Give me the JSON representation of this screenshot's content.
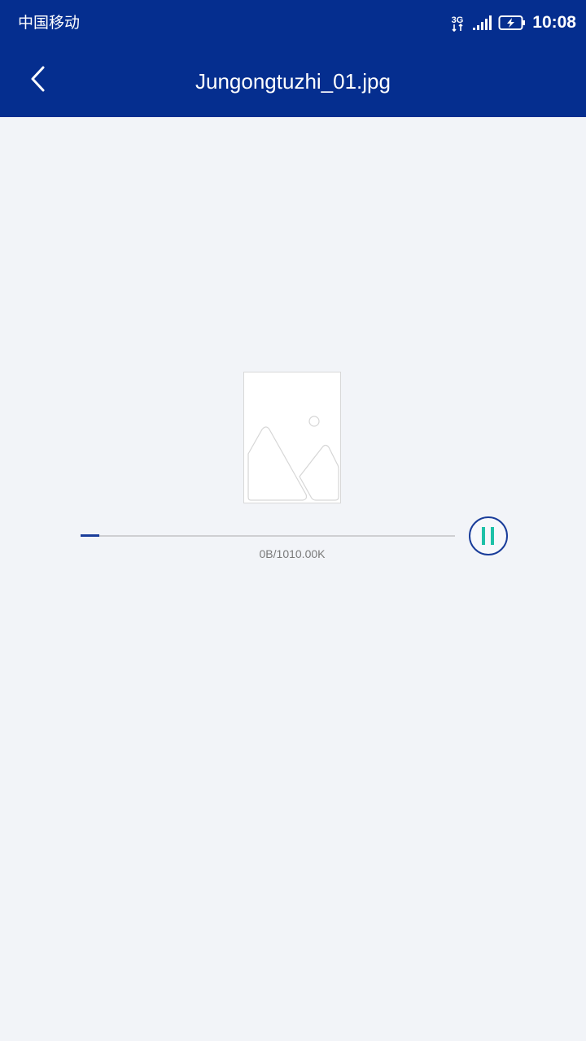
{
  "status_bar": {
    "carrier": "中国移动",
    "network_type": "3G",
    "time": "10:08",
    "icons": [
      "network-3g-icon",
      "signal-icon",
      "battery-charging-icon"
    ]
  },
  "nav": {
    "title": "Jungongtuzhi_01.jpg",
    "back_icon": "chevron-left-icon"
  },
  "download": {
    "progress_text": "0B/1010.00K",
    "progress_fraction": 0.05,
    "pause_icon": "pause-icon",
    "placeholder_icon": "image-placeholder-icon"
  },
  "colors": {
    "primary": "#052e8f",
    "progress": "#1a3d9a",
    "pause_bars": "#1fc1a8",
    "background": "#f2f4f8"
  }
}
